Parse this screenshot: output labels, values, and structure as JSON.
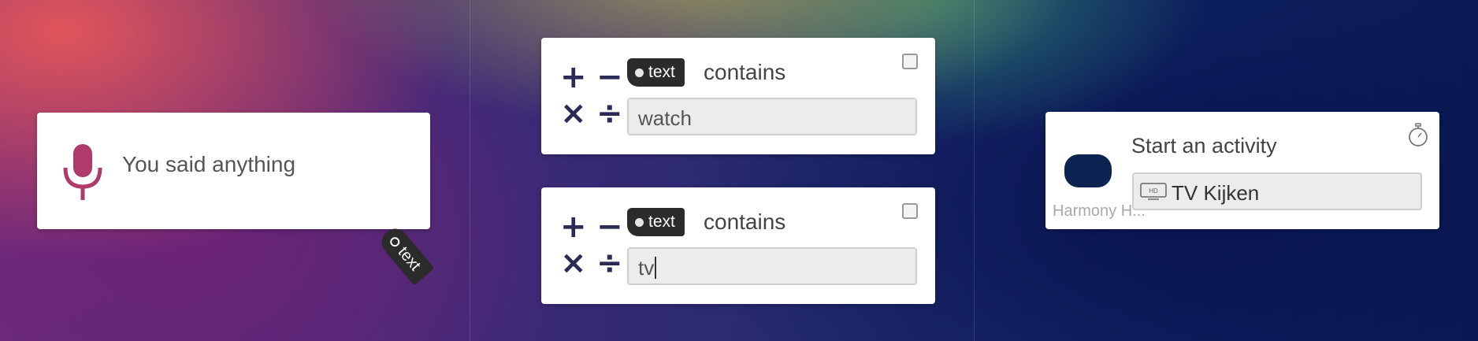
{
  "speech_card": {
    "label": "You said anything"
  },
  "floating_tag": {
    "label": "text"
  },
  "conditions": [
    {
      "tag": "text",
      "operator": "contains",
      "value": "watch",
      "checked": false
    },
    {
      "tag": "text",
      "operator": "contains",
      "value": "tv",
      "checked": false
    }
  ],
  "operators": {
    "plus": "+",
    "minus": "−",
    "times": "×",
    "divide": "÷"
  },
  "activity_card": {
    "title": "Start an activity",
    "device_name": "Harmony H...",
    "selected_activity": "TV Kijken",
    "hd_badge": "HD"
  },
  "colors": {
    "mic": "#b03a6a",
    "operator": "#2a2a55",
    "device": "#0d2452",
    "pill": "#2b2b2b"
  }
}
